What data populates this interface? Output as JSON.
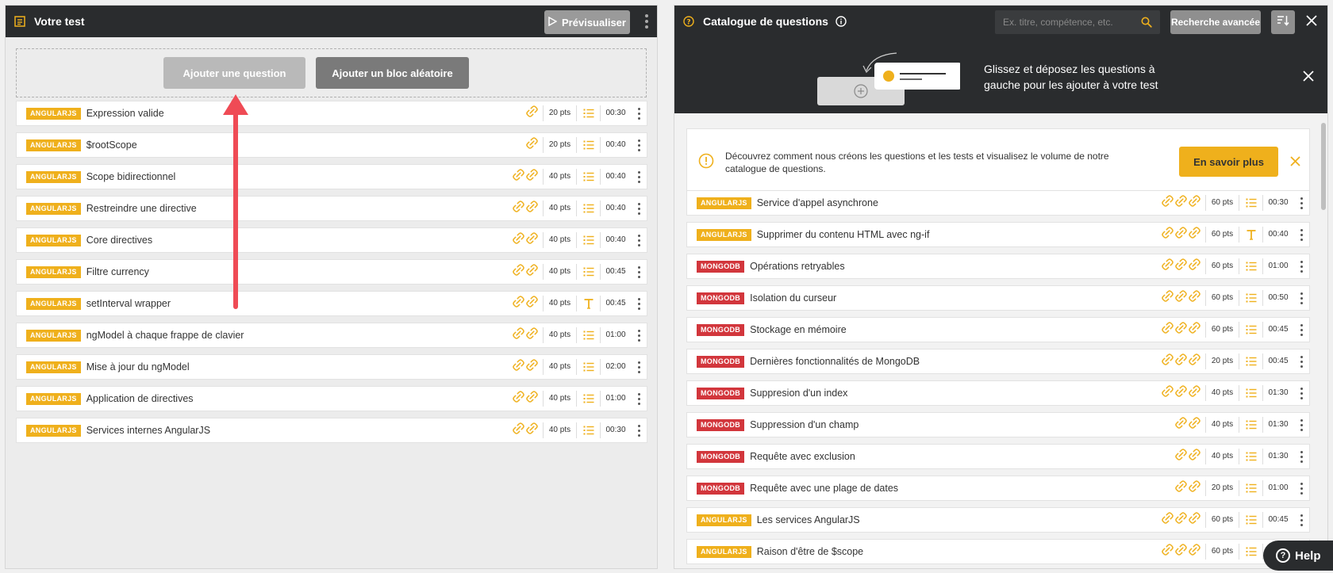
{
  "left": {
    "title": "Votre test",
    "preview_label": "Prévisualiser",
    "add_question_label": "Ajouter une question",
    "add_random_block_label": "Ajouter un bloc aléatoire",
    "questions": [
      {
        "tag": "ANGULARJS",
        "title": "Expression valide",
        "difficulty": 1,
        "points": "20 pts",
        "type": "list",
        "duration": "00:30"
      },
      {
        "tag": "ANGULARJS",
        "title": "$rootScope",
        "difficulty": 1,
        "points": "20 pts",
        "type": "list",
        "duration": "00:40"
      },
      {
        "tag": "ANGULARJS",
        "title": "Scope bidirectionnel",
        "difficulty": 2,
        "points": "40 pts",
        "type": "list",
        "duration": "00:40"
      },
      {
        "tag": "ANGULARJS",
        "title": "Restreindre une directive",
        "difficulty": 2,
        "points": "40 pts",
        "type": "list",
        "duration": "00:40"
      },
      {
        "tag": "ANGULARJS",
        "title": "Core directives",
        "difficulty": 2,
        "points": "40 pts",
        "type": "list",
        "duration": "00:40"
      },
      {
        "tag": "ANGULARJS",
        "title": "Filtre currency",
        "difficulty": 2,
        "points": "40 pts",
        "type": "list",
        "duration": "00:45"
      },
      {
        "tag": "ANGULARJS",
        "title": "setInterval wrapper",
        "difficulty": 2,
        "points": "40 pts",
        "type": "text",
        "duration": "00:45"
      },
      {
        "tag": "ANGULARJS",
        "title": "ngModel à chaque frappe de clavier",
        "difficulty": 2,
        "points": "40 pts",
        "type": "list",
        "duration": "01:00"
      },
      {
        "tag": "ANGULARJS",
        "title": "Mise à jour du ngModel",
        "difficulty": 2,
        "points": "40 pts",
        "type": "list",
        "duration": "02:00"
      },
      {
        "tag": "ANGULARJS",
        "title": "Application de directives",
        "difficulty": 2,
        "points": "40 pts",
        "type": "list",
        "duration": "01:00"
      },
      {
        "tag": "ANGULARJS",
        "title": "Services internes AngularJS",
        "difficulty": 2,
        "points": "40 pts",
        "type": "list",
        "duration": "00:30"
      }
    ]
  },
  "right": {
    "title": "Catalogue de questions",
    "search_placeholder": "Ex. titre, compétence, etc.",
    "advanced_search_label": "Recherche avancée",
    "banner_text": "Glissez et déposez les questions à gauche pour les ajouter à votre test",
    "info_text": "Découvrez comment nous créons les questions et les tests et visualisez le volume de notre catalogue de questions.",
    "learn_more_label": "En savoir plus",
    "questions": [
      {
        "tag": "ANGULARJS",
        "title": "Service d'appel asynchrone",
        "difficulty": 3,
        "points": "60 pts",
        "type": "list",
        "duration": "00:30"
      },
      {
        "tag": "ANGULARJS",
        "title": "Supprimer du contenu HTML avec ng-if",
        "difficulty": 3,
        "points": "60 pts",
        "type": "text",
        "duration": "00:40"
      },
      {
        "tag": "MONGODB",
        "title": "Opérations retryables",
        "difficulty": 3,
        "points": "60 pts",
        "type": "list",
        "duration": "01:00"
      },
      {
        "tag": "MONGODB",
        "title": "Isolation du curseur",
        "difficulty": 3,
        "points": "60 pts",
        "type": "list",
        "duration": "00:50"
      },
      {
        "tag": "MONGODB",
        "title": "Stockage en mémoire",
        "difficulty": 3,
        "points": "60 pts",
        "type": "list",
        "duration": "00:45"
      },
      {
        "tag": "MONGODB",
        "title": "Dernières fonctionnalités de MongoDB",
        "difficulty": 3,
        "points": "20 pts",
        "type": "list",
        "duration": "00:45"
      },
      {
        "tag": "MONGODB",
        "title": "Suppresion d'un index",
        "difficulty": 3,
        "points": "40 pts",
        "type": "list",
        "duration": "01:30"
      },
      {
        "tag": "MONGODB",
        "title": "Suppression d'un champ",
        "difficulty": 2,
        "points": "40 pts",
        "type": "list",
        "duration": "01:30"
      },
      {
        "tag": "MONGODB",
        "title": "Requête avec exclusion",
        "difficulty": 2,
        "points": "40 pts",
        "type": "list",
        "duration": "01:30"
      },
      {
        "tag": "MONGODB",
        "title": "Requête avec une plage de dates",
        "difficulty": 2,
        "points": "20 pts",
        "type": "list",
        "duration": "01:00"
      },
      {
        "tag": "ANGULARJS",
        "title": "Les services AngularJS",
        "difficulty": 3,
        "points": "60 pts",
        "type": "list",
        "duration": "00:45"
      },
      {
        "tag": "ANGULARJS",
        "title": "Raison d'être de $scope",
        "difficulty": 3,
        "points": "60 pts",
        "type": "list",
        "duration": ""
      }
    ]
  },
  "help_label": "Help",
  "colors": {
    "accent": "#efb01c",
    "dark": "#2a2c2e",
    "mongo": "#d2363c",
    "arrow": "#ef4b55"
  }
}
